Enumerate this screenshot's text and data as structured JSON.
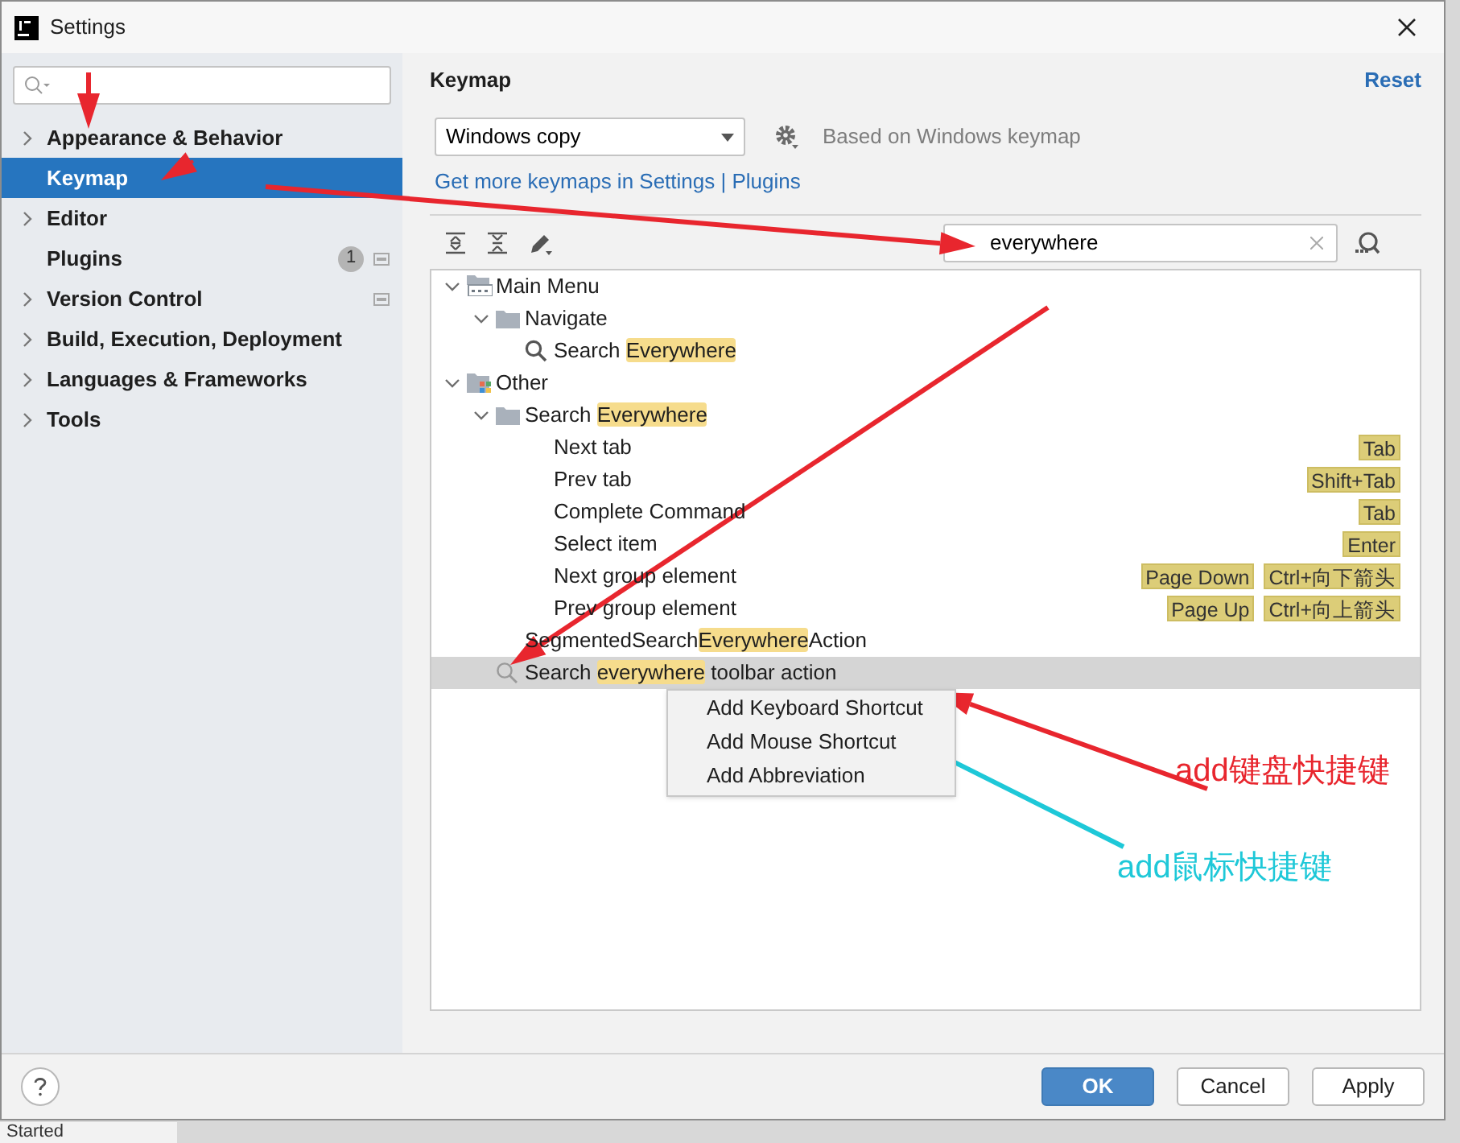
{
  "window": {
    "title": "Settings"
  },
  "sidebar": {
    "items": [
      {
        "label": "Appearance & Behavior",
        "expandable": true,
        "selected": false
      },
      {
        "label": "Keymap",
        "expandable": false,
        "selected": true
      },
      {
        "label": "Editor",
        "expandable": true,
        "selected": false
      },
      {
        "label": "Plugins",
        "expandable": false,
        "selected": false,
        "badge": "1",
        "page_icon": true
      },
      {
        "label": "Version Control",
        "expandable": true,
        "selected": false,
        "page_icon": true
      },
      {
        "label": "Build, Execution, Deployment",
        "expandable": true,
        "selected": false
      },
      {
        "label": "Languages & Frameworks",
        "expandable": true,
        "selected": false
      },
      {
        "label": "Tools",
        "expandable": true,
        "selected": false
      }
    ]
  },
  "panel": {
    "title": "Keymap",
    "reset": "Reset",
    "keymap": "Windows copy",
    "based_on": "Based on Windows keymap",
    "link": "Get more keymaps in Settings | Plugins",
    "search": "everywhere"
  },
  "tree": [
    {
      "label": [
        {
          "text": "Main Menu"
        }
      ],
      "kind": "menu",
      "expanded": true,
      "selected": false,
      "children": [
        {
          "label": [
            {
              "text": "Navigate"
            }
          ],
          "kind": "folder",
          "expanded": true,
          "selected": false,
          "children": [
            {
              "label": [
                {
                  "text": "Search "
                },
                {
                  "text": "Everywhere",
                  "hl": true
                }
              ],
              "kind": "search",
              "selected": false
            }
          ]
        }
      ]
    },
    {
      "label": [
        {
          "text": "Other"
        }
      ],
      "kind": "other",
      "expanded": true,
      "selected": false,
      "children": [
        {
          "label": [
            {
              "text": "Search "
            },
            {
              "text": "Everywhere",
              "hl": true
            }
          ],
          "kind": "folder",
          "expanded": true,
          "selected": false,
          "children": [
            {
              "label": [
                {
                  "text": "Next tab"
                }
              ],
              "selected": false,
              "shortcuts": [
                "Tab"
              ]
            },
            {
              "label": [
                {
                  "text": "Prev tab"
                }
              ],
              "selected": false,
              "shortcuts": [
                "Shift+Tab"
              ]
            },
            {
              "label": [
                {
                  "text": "Complete Command"
                }
              ],
              "selected": false,
              "shortcuts": [
                "Tab"
              ]
            },
            {
              "label": [
                {
                  "text": "Select item"
                }
              ],
              "selected": false,
              "shortcuts": [
                "Enter"
              ]
            },
            {
              "label": [
                {
                  "text": "Next group element"
                }
              ],
              "selected": false,
              "shortcuts": [
                "Page Down",
                "Ctrl+向下箭头"
              ]
            },
            {
              "label": [
                {
                  "text": "Prev group element"
                }
              ],
              "selected": false,
              "shortcuts": [
                "Page Up",
                "Ctrl+向上箭头"
              ]
            }
          ]
        },
        {
          "label": [
            {
              "text": "SegmentedSearch"
            },
            {
              "text": "Everywhere",
              "hl": true
            },
            {
              "text": "Action"
            }
          ],
          "selected": false
        },
        {
          "label": [
            {
              "text": "Search "
            },
            {
              "text": "everywhere",
              "hl": true
            },
            {
              "text": " toolbar action"
            }
          ],
          "kind": "search-light",
          "selected": true
        }
      ]
    }
  ],
  "context_menu": [
    "Add Keyboard Shortcut",
    "Add Mouse Shortcut",
    "Add Abbreviation"
  ],
  "annotations": [
    {
      "text": "add键盘快捷键",
      "color": "#e8262e"
    },
    {
      "text": "add鼠标快捷键",
      "color": "#1ec8d8"
    }
  ],
  "buttons": [
    {
      "label": "OK",
      "primary": true
    },
    {
      "label": "Cancel",
      "primary": false
    },
    {
      "label": "Apply",
      "primary": false
    }
  ],
  "background_text": "Started"
}
